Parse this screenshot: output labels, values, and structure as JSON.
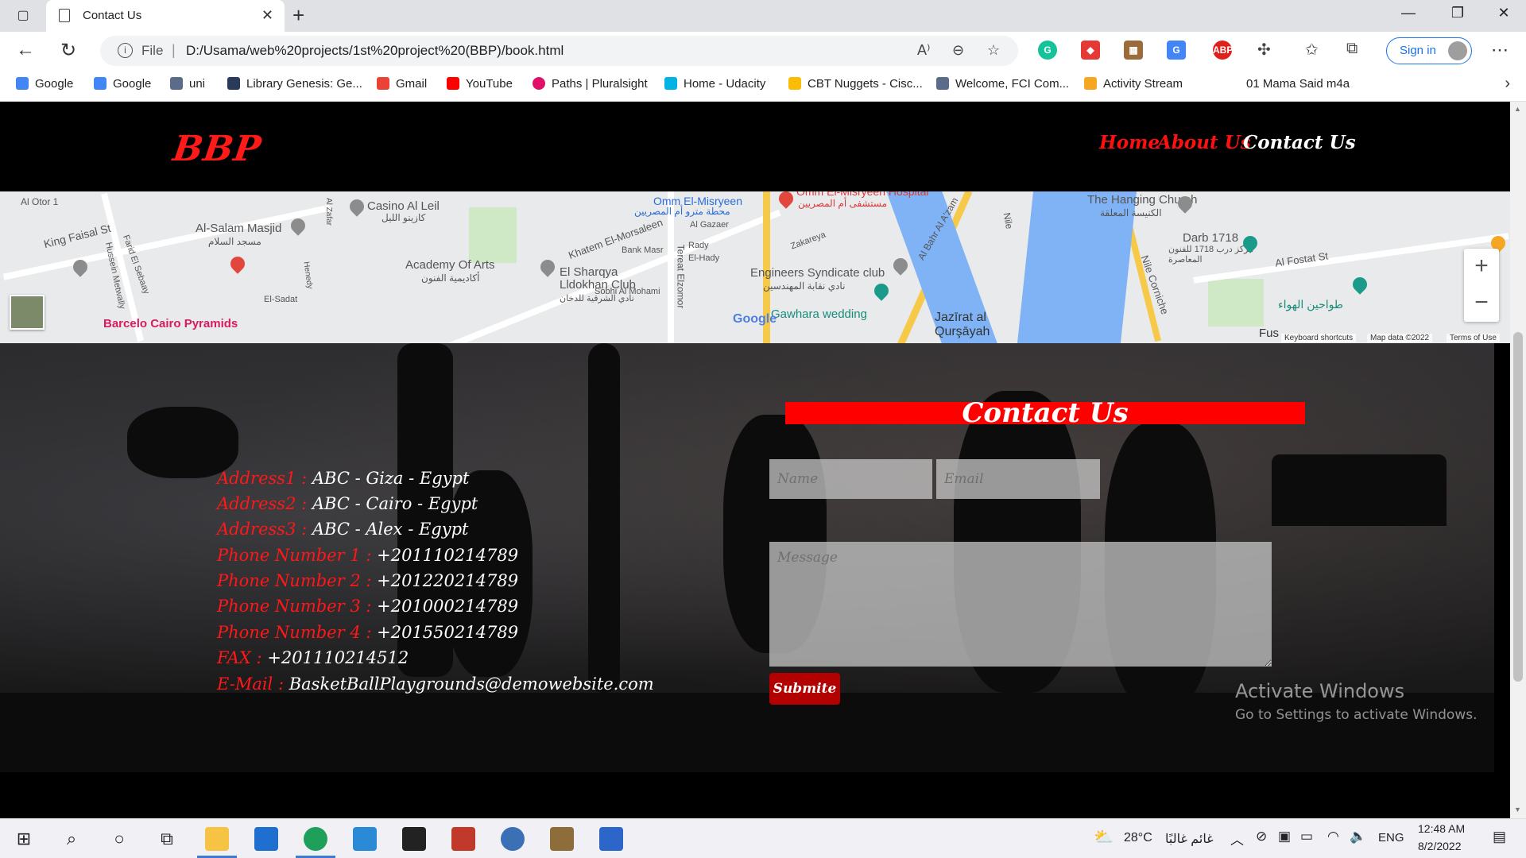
{
  "browser": {
    "tab_title": "Contact Us",
    "url_scheme_label": "File",
    "url": "D:/Usama/web%20projects/1st%20project%20(BBP)/book.html",
    "signin_label": "Sign in",
    "bookmarks": [
      {
        "label": "Google",
        "color": "#4285f4"
      },
      {
        "label": "Google",
        "color": "#4285f4"
      },
      {
        "label": "uni",
        "color": "#5a6c8a"
      },
      {
        "label": "Library Genesis: Ge...",
        "color": "#2a3a5a"
      },
      {
        "label": "Gmail",
        "color": "#ea4335"
      },
      {
        "label": "YouTube",
        "color": "#ff0000"
      },
      {
        "label": "Paths | Pluralsight",
        "color": "#e0106a"
      },
      {
        "label": "Home - Udacity",
        "color": "#02b3e4"
      },
      {
        "label": "CBT Nuggets - Cisc...",
        "color": "#fbbc05"
      },
      {
        "label": "Welcome, FCI Com...",
        "color": "#5a6c8a"
      },
      {
        "label": "Activity Stream",
        "color": "#f5a623"
      },
      {
        "label": "01 Mama Said m4a",
        "color": "#ffffff"
      }
    ]
  },
  "site": {
    "logo": "BBP",
    "nav": [
      {
        "label": "Home",
        "active": false
      },
      {
        "label": "About Us",
        "active": false
      },
      {
        "label": "Contact Us",
        "active": true
      }
    ]
  },
  "map": {
    "labels": [
      "Al Otor 1",
      "King Faisal St",
      "Al-Salam Masjid",
      "مسجد السلام",
      "Casino Al Leil",
      "كازينو الليل",
      "Academy Of Arts",
      "أكاديمية الفنون",
      "El Sharqya Lldokhan Club",
      "نادي الشرقية للدخان",
      "Khatem El-Morsaleen",
      "Omm El-Misryeen",
      "محطة مترو أم المصريين",
      "Omm El-Misryeen Hospital",
      "مستشفى أم المصريين",
      "Engineers Syndicate club",
      "نادي نقابة المهندسين",
      "Gawhara wedding",
      "Jazīrat al Qurşāyah",
      "The Hanging Church",
      "الكنيسة المعلقة",
      "Darb 1718",
      "مركز درب 1718 للفنون المعاصرة",
      "Al Fostat St",
      "طواحين الهواء",
      "Nile Corniche",
      "Barcelo Cairo Pyramids",
      "Tereat Elzomor",
      "Al Bahr Al A'zam",
      "El-Sadat",
      "Al Gazaer",
      "Bank Masr",
      "El-Hady",
      "Rady",
      "Zakareya",
      "Sobhi Al Mohami",
      "Hussein Metwally",
      "Farid El Sebaay",
      "Nile",
      "Fus",
      "Al Zafar",
      "Henedy"
    ],
    "attribution": {
      "google": "Google",
      "shortcuts": "Keyboard shortcuts",
      "map_data": "Map data ©2022",
      "terms": "Terms of Use"
    }
  },
  "contact": {
    "title": "Contact Us",
    "info": [
      {
        "label": "Address1 :",
        "value": "ABC - Giza - Egypt"
      },
      {
        "label": "Address2 :",
        "value": "ABC - Cairo - Egypt"
      },
      {
        "label": "Address3 :",
        "value": "ABC - Alex - Egypt"
      },
      {
        "label": "Phone Number 1 :",
        "value": "+201110214789"
      },
      {
        "label": "Phone Number 2 :",
        "value": "+201220214789"
      },
      {
        "label": "Phone Number 3 :",
        "value": "+201000214789"
      },
      {
        "label": "Phone Number 4 :",
        "value": "+201550214789"
      },
      {
        "label": "FAX :",
        "value": "+201110214512"
      },
      {
        "label": "E-Mail :",
        "value": "BasketBallPlaygrounds@demowebsite.com"
      }
    ],
    "form": {
      "name_placeholder": "Name",
      "email_placeholder": "Email",
      "message_placeholder": "Message",
      "submit_label": "Submite"
    }
  },
  "watermark": {
    "line1": "Activate Windows",
    "line2": "Go to Settings to activate Windows."
  },
  "taskbar": {
    "weather_temp": "28°C",
    "weather_text": "غائم غالبًا",
    "language": "ENG",
    "time": "12:48 AM",
    "date": "8/2/2022"
  },
  "colors": {
    "accent_red": "#ff0000",
    "submit_red": "#b30000",
    "header_bg": "#000000",
    "link_blue": "#1a73e8"
  }
}
